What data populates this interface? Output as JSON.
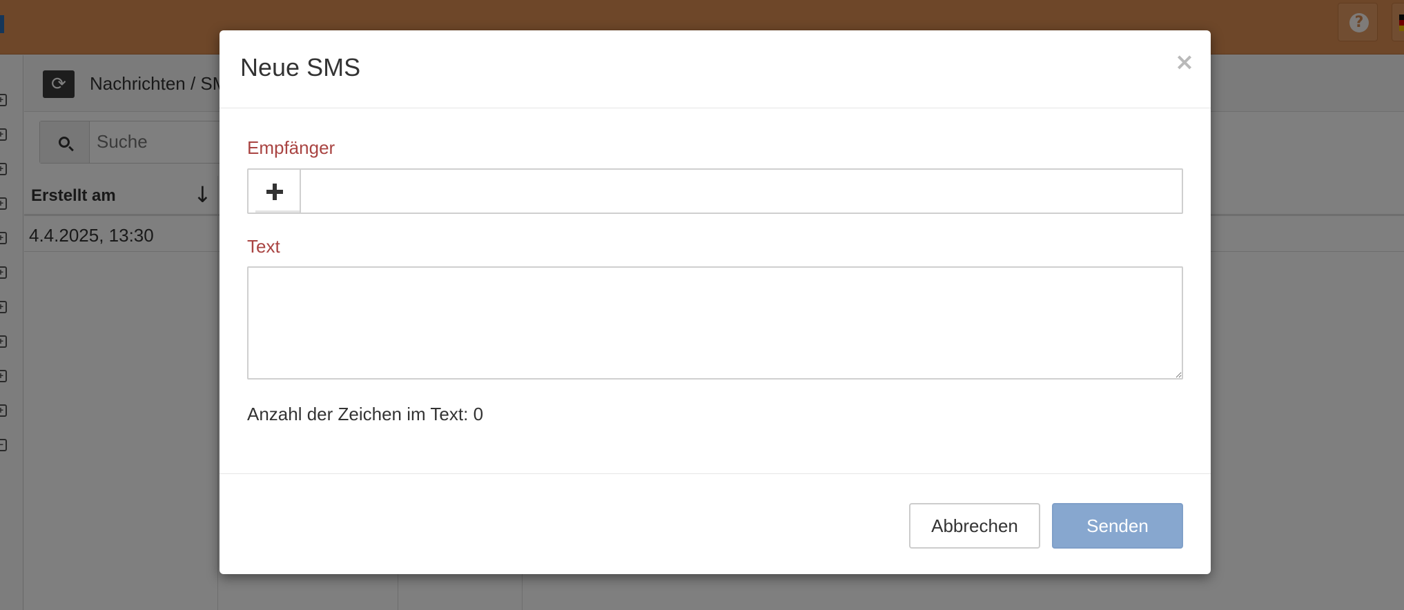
{
  "background": {
    "breadcrumb": "Nachrichten / SMS",
    "search_placeholder": "Suche",
    "table": {
      "columns": [
        "Erstellt am"
      ],
      "sort_icon": "↓",
      "rows": [
        [
          "4.4.2025, 13:30"
        ]
      ]
    },
    "help_icon": "?",
    "refresh_icon": "⟳"
  },
  "modal": {
    "title": "Neue SMS",
    "close_symbol": "×",
    "recipient_label": "Empfänger",
    "recipient_value": "",
    "text_label": "Text",
    "text_value": "",
    "char_count_label": "Anzahl der Zeichen im Text:",
    "char_count": "0",
    "cancel_label": "Abbrechen",
    "send_label": "Senden"
  },
  "colors": {
    "topbar": "#dd8e53",
    "label_red": "#a94442",
    "send_button": "#87a7cf"
  }
}
